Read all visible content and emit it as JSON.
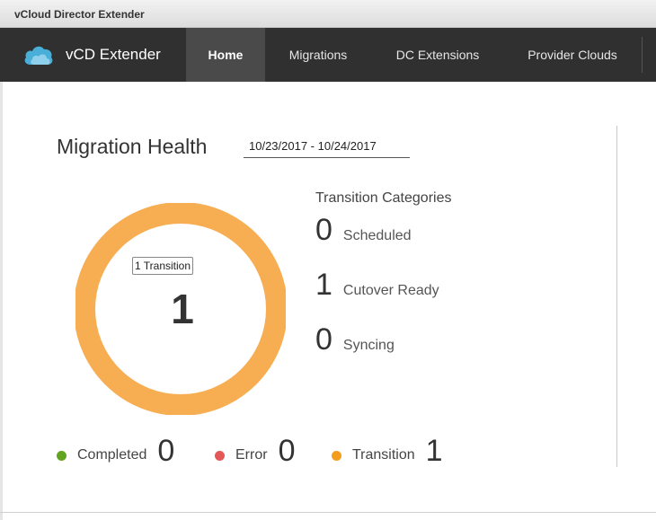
{
  "window": {
    "title": "vCloud Director Extender"
  },
  "navbar": {
    "brand": "vCD Extender",
    "items": [
      {
        "label": "Home",
        "active": true
      },
      {
        "label": "Migrations",
        "active": false
      },
      {
        "label": "DC Extensions",
        "active": false
      },
      {
        "label": "Provider Clouds",
        "active": false
      }
    ]
  },
  "migration_health": {
    "title": "Migration Health",
    "date_range": "10/23/2017 - 10/24/2017",
    "donut": {
      "total": "1",
      "tooltip": "1 Transition",
      "color": "#f7ae53"
    },
    "categories_title": "Transition Categories",
    "categories": [
      {
        "count": "0",
        "label": "Scheduled"
      },
      {
        "count": "1",
        "label": "Cutover Ready"
      },
      {
        "count": "0",
        "label": "Syncing"
      }
    ],
    "legend": [
      {
        "label": "Completed",
        "count": "0",
        "color": "#62a420"
      },
      {
        "label": "Error",
        "count": "0",
        "color": "#e45858"
      },
      {
        "label": "Transition",
        "count": "1",
        "color": "#f39c1e"
      }
    ]
  },
  "colors": {
    "navbar": "#303030",
    "nav_active": "#4a4a4a",
    "logo_blue": "#49afd9"
  }
}
